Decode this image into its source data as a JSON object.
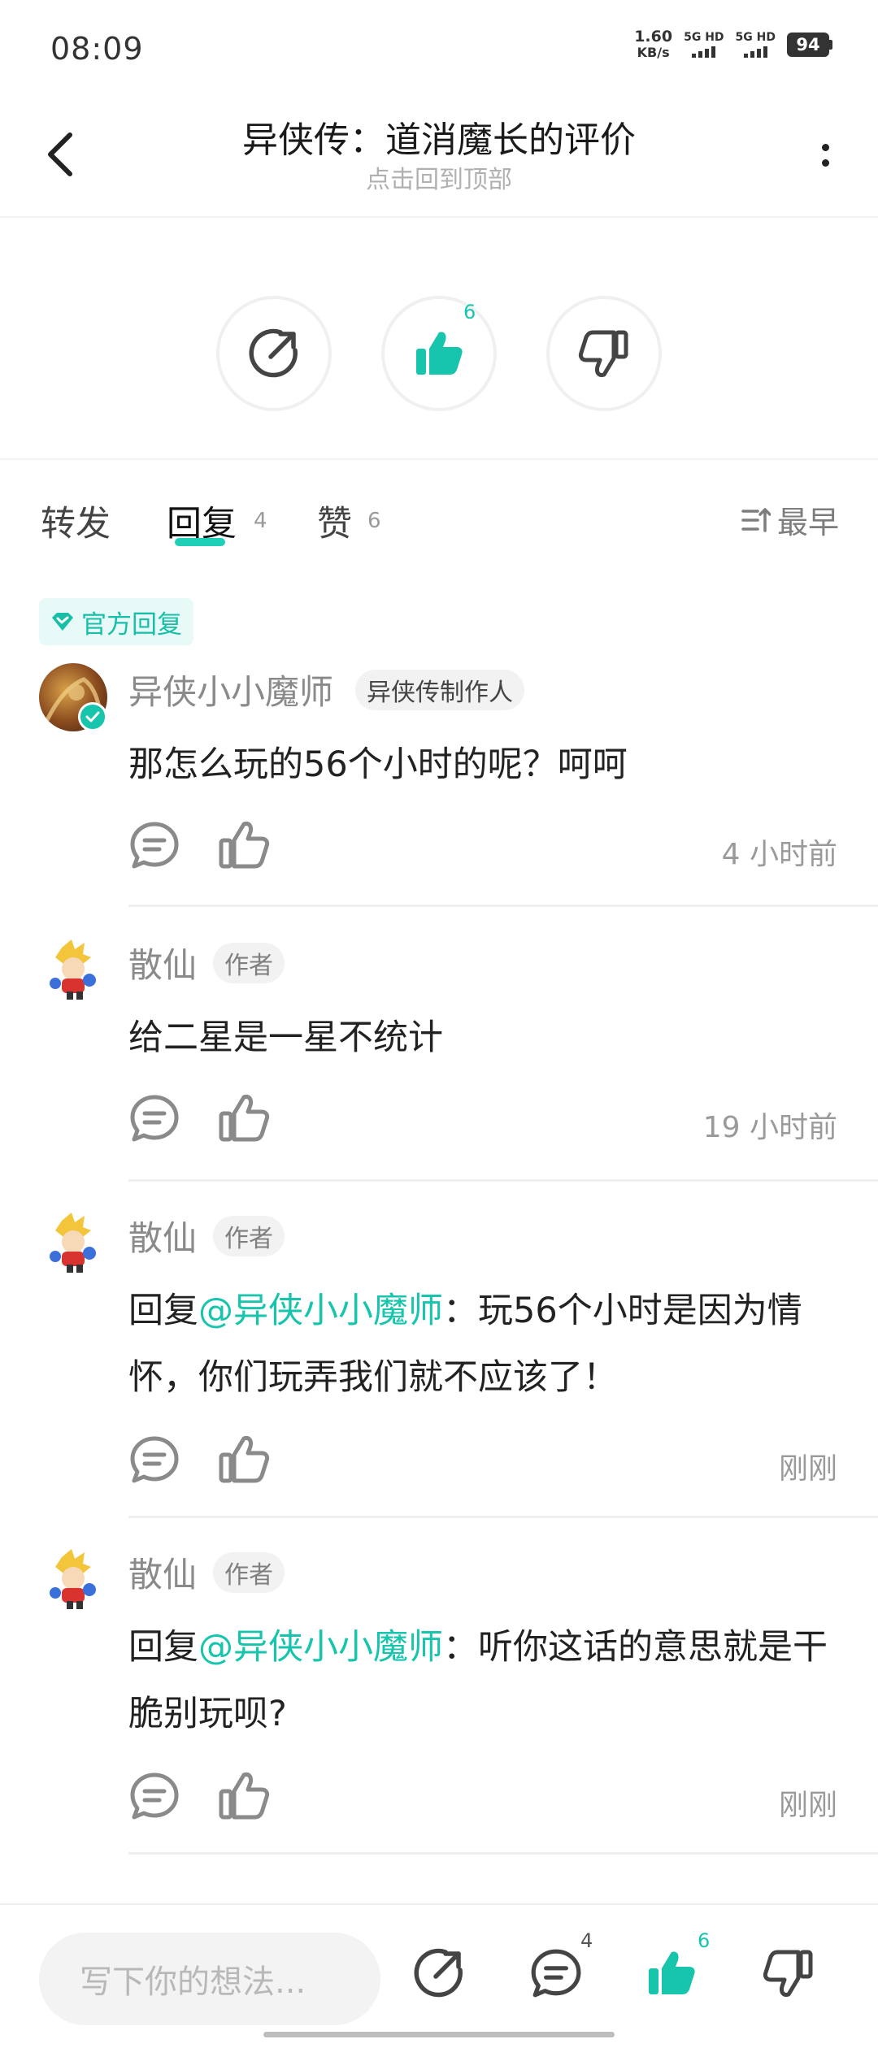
{
  "status_bar": {
    "time": "08:09",
    "net_speed_value": "1.60",
    "net_speed_unit": "KB/s",
    "sim1_label": "5G HD",
    "sim2_label": "5G HD",
    "battery": "94"
  },
  "header": {
    "title": "异侠传：道消魔长的评价",
    "subtitle": "点击回到顶部"
  },
  "actions": {
    "like_count": "6",
    "icons": [
      "share-icon",
      "thumbs-up-icon",
      "thumbs-down-icon"
    ],
    "accent_color": "#17c5ad"
  },
  "tabs": {
    "items": [
      {
        "label": "转发",
        "count": ""
      },
      {
        "label": "回复",
        "count": "4"
      },
      {
        "label": "赞",
        "count": "6"
      }
    ],
    "active": "回复",
    "sort_label": "最早"
  },
  "official_badge": "官方回复",
  "comments": [
    {
      "author": "异侠小小魔师",
      "tag": "异侠传制作人",
      "content": "那怎么玩的56个小时的呢？呵呵",
      "time": "4 小时前"
    },
    {
      "author": "散仙",
      "tag": "作者",
      "content": "给二星是一星不统计",
      "time": "19 小时前"
    },
    {
      "author": "散仙",
      "tag": "作者",
      "reply_prefix": "回复",
      "mention": "@异侠小小魔师",
      "content": "：玩56个小时是因为情怀，你们玩弄我们就不应该了！",
      "time": "刚刚"
    },
    {
      "author": "散仙",
      "tag": "作者",
      "reply_prefix": "回复",
      "mention": "@异侠小小魔师",
      "content": "：听你这话的意思就是干脆别玩呗?",
      "time": "刚刚"
    }
  ],
  "bottom_bar": {
    "input_placeholder": "写下你的想法...",
    "comment_count": "4",
    "like_count": "6"
  }
}
